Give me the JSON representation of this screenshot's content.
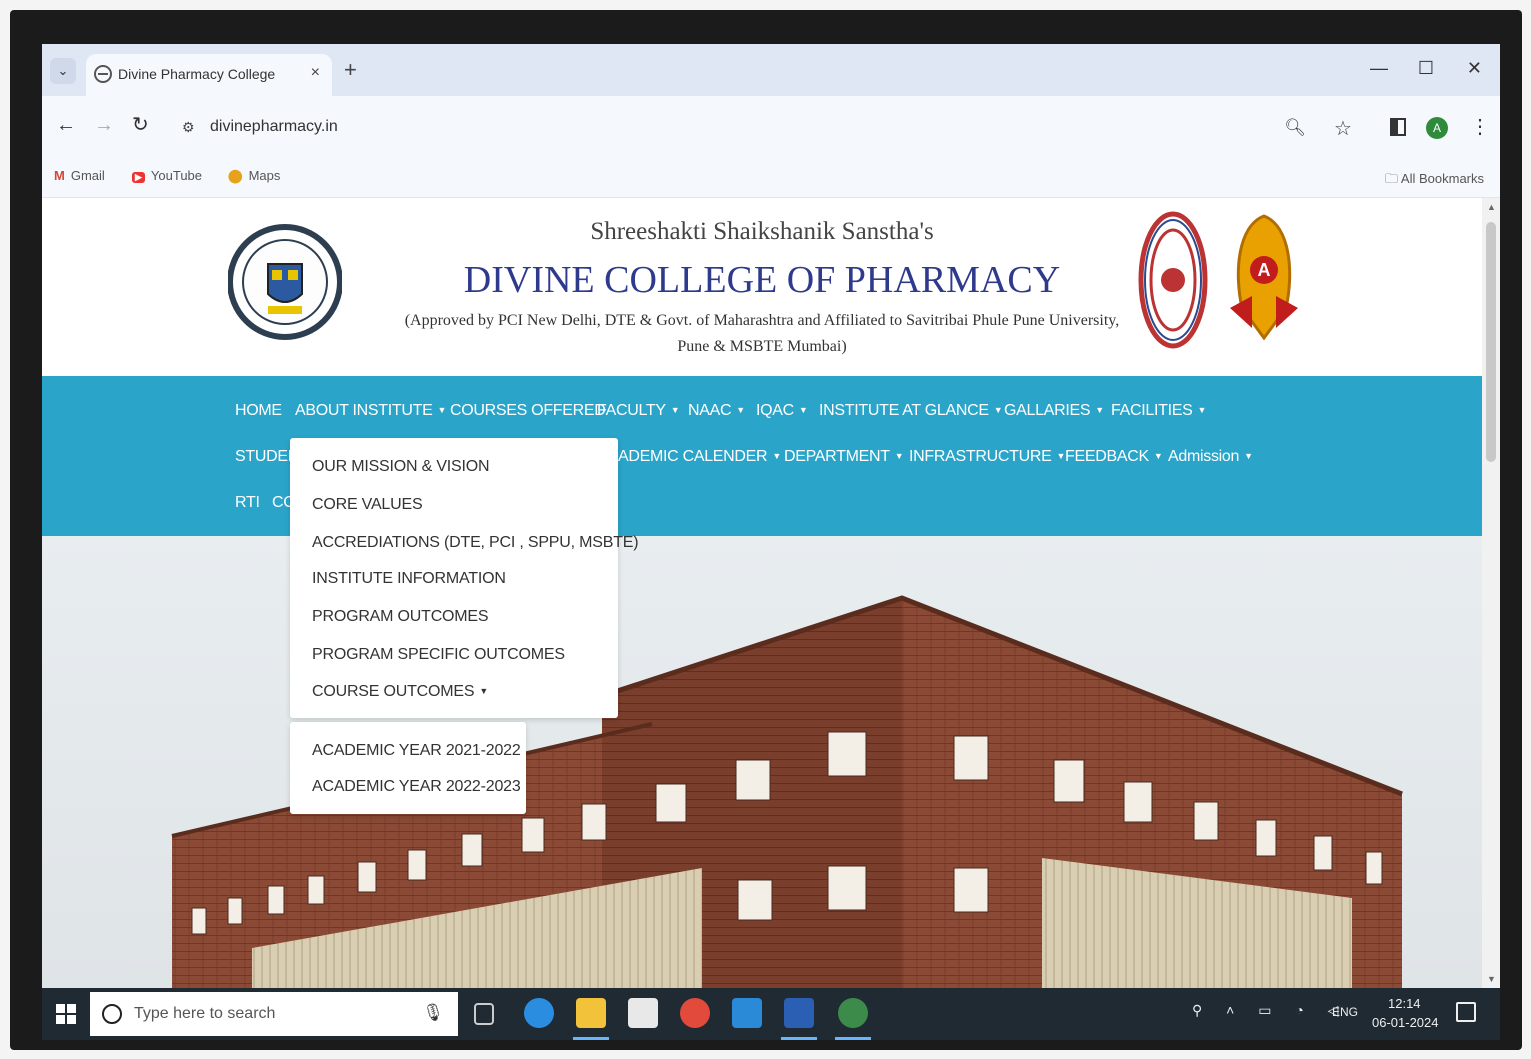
{
  "browser": {
    "tab_title": "Divine Pharmacy College",
    "tab_close": "×",
    "new_tab": "+",
    "url": "divinepharmacy.in",
    "bookmarks": [
      {
        "label": "Gmail",
        "icon": "gmail-icon"
      },
      {
        "label": "YouTube",
        "icon": "youtube-icon"
      },
      {
        "label": "Maps",
        "icon": "maps-icon"
      }
    ],
    "all_bookmarks": "All Bookmarks",
    "profile_initial": "A"
  },
  "header": {
    "subtitle": "Shreeshakti Shaikshanik Sanstha's",
    "title": "DIVINE COLLEGE OF PHARMACY",
    "approval_line1": "(Approved by PCI New Delhi, DTE & Govt. of Maharashtra and Affiliated to Savitribai Phule Pune University,",
    "approval_line2": "Pune & MSBTE Mumbai)",
    "naac_letter": "A"
  },
  "nav": {
    "row1": [
      {
        "label": "HOME",
        "caret": false
      },
      {
        "label": "ABOUT INSTITUTE",
        "caret": true
      },
      {
        "label": "COURSES OFFERED",
        "caret": false
      },
      {
        "label": "FACULTY",
        "caret": true
      },
      {
        "label": "NAAC",
        "caret": true
      },
      {
        "label": "IQAC",
        "caret": true
      },
      {
        "label": "INSTITUTE AT GLANCE",
        "caret": true
      },
      {
        "label": "GALLARIES",
        "caret": true
      },
      {
        "label": "FACILITIES",
        "caret": true
      }
    ],
    "row2_left": "STUDEN",
    "row2": [
      {
        "label": "ADEMIC CALENDER",
        "caret": true
      },
      {
        "label": "DEPARTMENT",
        "caret": true
      },
      {
        "label": "INFRASTRUCTURE",
        "caret": true
      },
      {
        "label": "FEEDBACK",
        "caret": true
      },
      {
        "label": "Admission",
        "caret": true
      }
    ],
    "row3": [
      "RTI",
      "CC"
    ]
  },
  "about_dropdown": {
    "items": [
      "OUR MISSION & VISION",
      "CORE VALUES",
      "ACCREDIATIONS (DTE, PCI , SPPU, MSBTE)",
      "INSTITUTE INFORMATION",
      "PROGRAM OUTCOMES",
      "PROGRAM SPECIFIC OUTCOMES",
      "COURSE OUTCOMES"
    ],
    "course_outcomes_sub": [
      "ACADEMIC YEAR 2021-2022",
      "ACADEMIC YEAR 2022-2023"
    ]
  },
  "taskbar": {
    "search_placeholder": "Type here to search",
    "language": "ENG",
    "time": "12:14",
    "date": "06-01-2024"
  },
  "colors": {
    "nav_bg": "#2aa4c9",
    "title_color": "#2e3a8c"
  }
}
